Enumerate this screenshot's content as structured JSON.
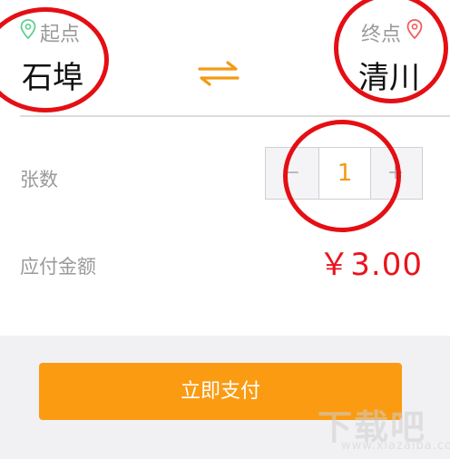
{
  "route": {
    "origin_label": "起点",
    "origin_city": "石埠",
    "destination_label": "终点",
    "destination_city": "清川",
    "origin_pin_icon": "location-pin-green",
    "destination_pin_icon": "location-pin-red",
    "swap_icon": "swap-arrows"
  },
  "ticket": {
    "count_label": "张数",
    "minus_symbol": "−",
    "count_value": "1",
    "plus_symbol": "+"
  },
  "amount": {
    "label": "应付金额",
    "value": "￥3.00"
  },
  "pay_button": {
    "label": "立即支付"
  },
  "watermark": {
    "text": "下载吧",
    "url": "www.xiazaiba.com"
  },
  "colors": {
    "accent_orange": "#fb9b12",
    "price_red": "#e8151d",
    "annotation_red": "#e40f14",
    "pin_green": "#5fcf8e",
    "pin_red": "#f25a5a"
  }
}
